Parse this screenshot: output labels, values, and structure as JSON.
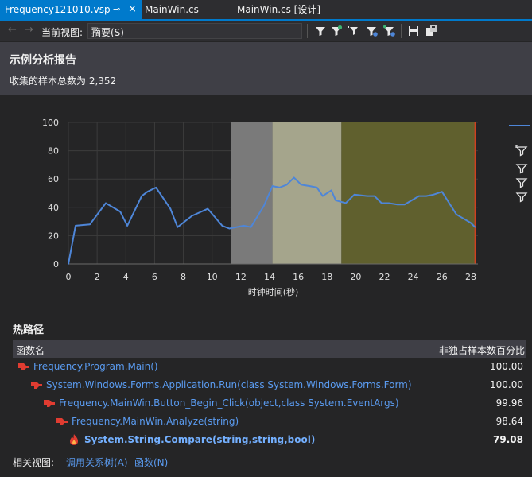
{
  "tabs": [
    {
      "label": "Frequency121010.vsp",
      "pin": "⊸",
      "close": "×"
    },
    {
      "label": "MainWin.cs"
    },
    {
      "label": "MainWin.cs [设计]"
    }
  ],
  "toolbar": {
    "back": "←",
    "forward": "→",
    "current_view_label": "当前视图:",
    "current_view_value": "摘要(S)"
  },
  "report": {
    "title": "示例分析报告",
    "sample_total": "收集的样本总数为 2,352"
  },
  "chart_data": {
    "type": "line",
    "xlabel": "时钟时间(秒)",
    "ylabel": "",
    "xlim": [
      0,
      28.5
    ],
    "ylim": [
      0,
      100
    ],
    "x_ticks": [
      0,
      2,
      4,
      6,
      8,
      10,
      12,
      14,
      16,
      18,
      20,
      22,
      24,
      26,
      28
    ],
    "y_ticks": [
      0,
      20,
      40,
      60,
      80,
      100
    ],
    "grid": true,
    "highlight_regions": [
      {
        "from": 11.3,
        "to": 14.2,
        "color": "#7a7a7a"
      },
      {
        "from": 14.2,
        "to": 19.0,
        "color": "#a5a58c"
      },
      {
        "from": 19.0,
        "to": 28.3,
        "color": "#60602e"
      }
    ],
    "end_marker_x": 28.3,
    "series": [
      {
        "color": "#4e86d8",
        "x": [
          0,
          0.5,
          1.5,
          2.6,
          3.6,
          4.1,
          5.1,
          5.5,
          6.1,
          7.1,
          7.6,
          8.6,
          9.7,
          10.7,
          11.2,
          12.2,
          12.7,
          13.6,
          14.2,
          14.7,
          15.2,
          15.7,
          16.2,
          16.8,
          17.3,
          17.7,
          18.3,
          18.6,
          19.3,
          19.9,
          20.8,
          21.3,
          21.8,
          22.3,
          22.9,
          23.4,
          23.9,
          24.4,
          24.9,
          25.4,
          26.0,
          27.0,
          28.0,
          28.3
        ],
        "y": [
          0,
          27,
          28,
          43,
          37,
          27,
          48,
          51,
          54,
          39,
          26,
          34,
          39,
          27,
          25,
          27,
          26,
          41,
          55,
          54,
          56,
          61,
          56,
          55,
          54,
          48,
          52,
          45,
          43,
          49,
          48,
          48,
          43,
          43,
          42,
          42,
          45,
          48,
          48,
          49,
          51,
          35,
          29,
          26
        ]
      }
    ]
  },
  "hot_path": {
    "title": "热路径",
    "col_function": "函数名",
    "col_percent": "非独占样本数百分比",
    "rows": [
      {
        "name": "Frequency.Program.Main()",
        "percent": "100.00"
      },
      {
        "name": "System.Windows.Forms.Application.Run(class System.Windows.Forms.Form)",
        "percent": "100.00"
      },
      {
        "name": "Frequency.MainWin.Button_Begin_Click(object,class System.EventArgs)",
        "percent": "99.96"
      },
      {
        "name": "Frequency.MainWin.Analyze(string)",
        "percent": "98.64"
      },
      {
        "name": "System.String.Compare(string,string,bool)",
        "percent": "79.08"
      }
    ]
  },
  "related": {
    "label": "相关视图:",
    "call_tree": "调用关系树(A)",
    "functions": "函数(N)"
  },
  "colors": {
    "accent": "#007acc",
    "link": "#5a9bf0",
    "hot_icon": "#e03c31"
  }
}
